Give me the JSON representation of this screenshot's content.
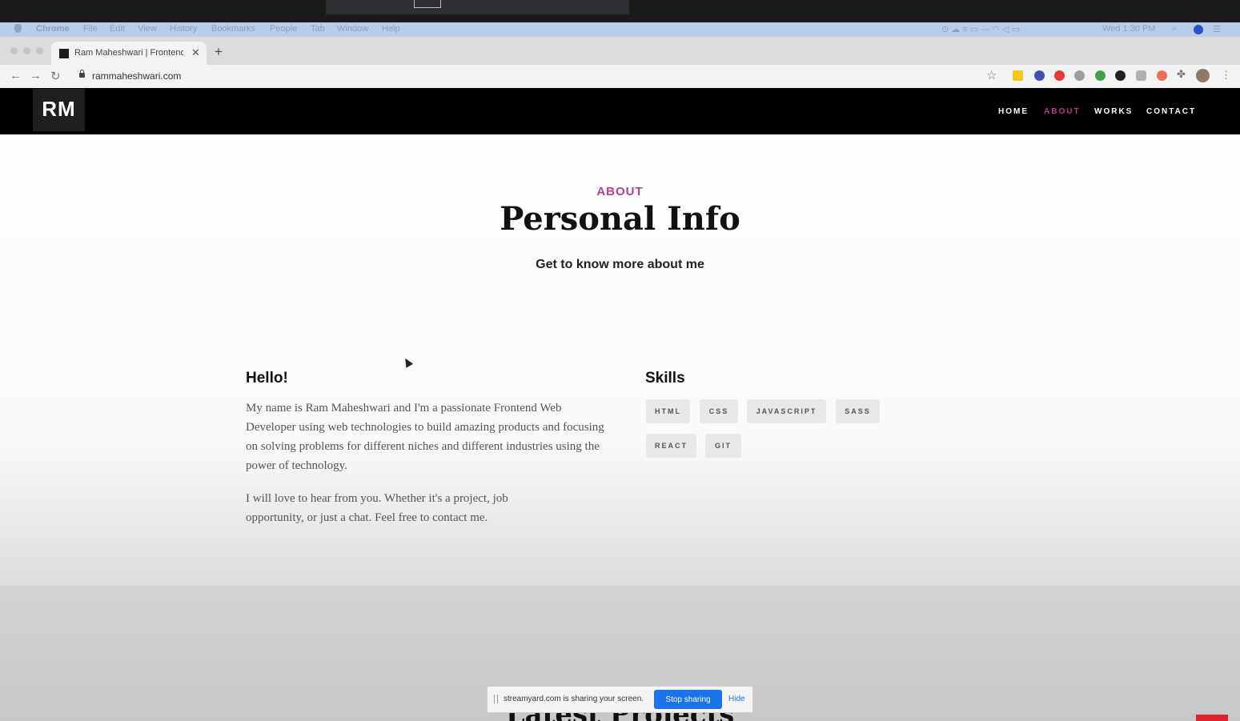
{
  "menubar": {
    "app": "Chrome",
    "items": [
      "File",
      "Edit",
      "View",
      "History",
      "Bookmarks",
      "People",
      "Tab",
      "Window",
      "Help"
    ],
    "clock": "Wed 1:30 PM"
  },
  "browser": {
    "tab_title": "Ram Maheshwari | Frontend W",
    "url": "rammaheshwari.com"
  },
  "site": {
    "logo": "RM",
    "nav": [
      {
        "label": "HOME",
        "active": false
      },
      {
        "label": "ABOUT",
        "active": true
      },
      {
        "label": "WORKS",
        "active": false
      },
      {
        "label": "CONTACT",
        "active": false
      }
    ],
    "about": {
      "kicker": "ABOUT",
      "title": "Personal Info",
      "subtitle": "Get to know more about me",
      "hello_heading": "Hello!",
      "para1": "My name is Ram Maheshwari and I'm a passionate Frontend Web Developer using web technologies to build amazing products and focusing on solving problems for different niches and different industries using the power of technology.",
      "para2": "I will love to hear from you. Whether it's a project, job opportunity, or just a chat. Feel free to contact me.",
      "skills_heading": "Skills",
      "skills": [
        "HTML",
        "CSS",
        "JAVASCRIPT",
        "SASS",
        "REACT",
        "GIT"
      ]
    },
    "next_section_title": "Latest Projects"
  },
  "sharebar": {
    "message": "streamyard.com is sharing your screen.",
    "stop_label": "Stop sharing",
    "hide_label": "Hide"
  },
  "colors": {
    "accent": "#b43e8f",
    "header_bg": "#000000",
    "share_button": "#1a73e8"
  }
}
